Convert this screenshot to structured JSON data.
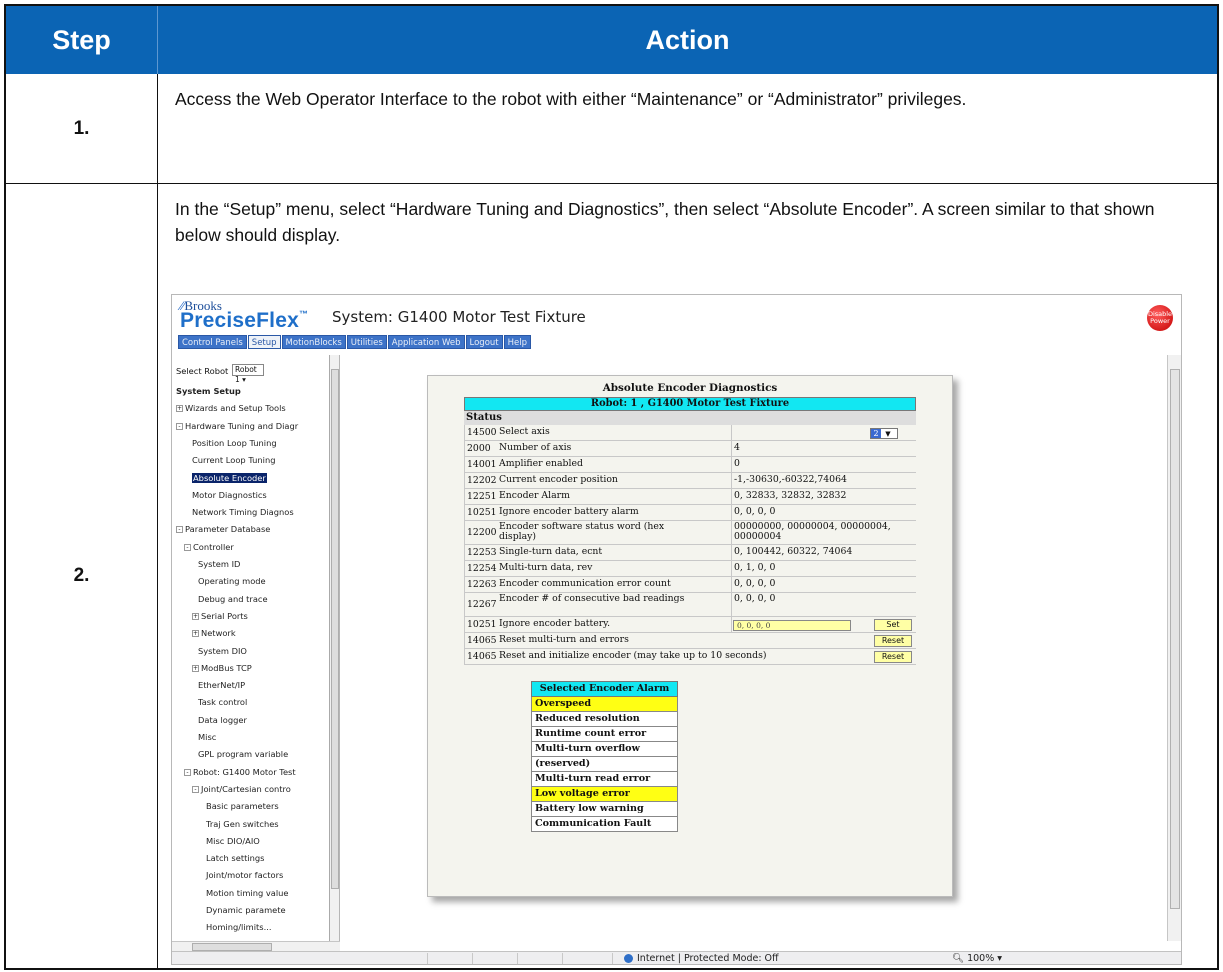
{
  "table": {
    "headers": {
      "step": "Step",
      "action": "Action"
    },
    "rows": [
      {
        "step": "1.",
        "action": "Access the Web Operator Interface to the robot with either “Maintenance” or “Administrator” privileges."
      },
      {
        "step": "2.",
        "action": "In the “Setup” menu, select “Hardware Tuning and Diagnostics”, then select “Absolute Encoder”.  A screen similar to that shown below should display."
      }
    ]
  },
  "screenshot": {
    "logo_brooks": "Brooks",
    "logo_preciseflex": "PreciseFlex",
    "logo_tm": "™",
    "system_title": "System: G1400 Motor Test Fixture",
    "disable_power": "Disable Power",
    "nav": [
      "Control Panels",
      "Setup",
      "MotionBlocks",
      "Utilities",
      "Application Web",
      "Logout",
      "Help"
    ],
    "select_robot_label": "Select Robot",
    "select_robot_value": "Robot 1",
    "tree": [
      {
        "label": "System Setup",
        "bold": true,
        "indent": 0
      },
      {
        "label": "Wizards and Setup Tools",
        "exp": "+",
        "indent": 0
      },
      {
        "label": "Hardware Tuning and Diagr",
        "exp": "-",
        "indent": 0
      },
      {
        "label": "Position Loop Tuning",
        "indent": 2
      },
      {
        "label": "Current Loop Tuning",
        "indent": 2
      },
      {
        "label": "Absolute Encoder",
        "indent": 2,
        "selected": true
      },
      {
        "label": "Motor Diagnostics",
        "indent": 2
      },
      {
        "label": "Network Timing Diagnos",
        "indent": 2
      },
      {
        "label": "Parameter Database",
        "exp": "-",
        "indent": 0
      },
      {
        "label": "Controller",
        "exp": "-",
        "indent": 1
      },
      {
        "label": "System ID",
        "indent": 3
      },
      {
        "label": "Operating mode",
        "indent": 3
      },
      {
        "label": "Debug and trace",
        "indent": 3
      },
      {
        "label": "Serial Ports",
        "exp": "+",
        "indent": 2
      },
      {
        "label": "Network",
        "exp": "+",
        "indent": 2
      },
      {
        "label": "System DIO",
        "indent": 3
      },
      {
        "label": "ModBus TCP",
        "exp": "+",
        "indent": 2
      },
      {
        "label": "EtherNet/IP",
        "indent": 3
      },
      {
        "label": "Task control",
        "indent": 3
      },
      {
        "label": "Data logger",
        "indent": 3
      },
      {
        "label": "Misc",
        "indent": 3
      },
      {
        "label": "GPL program variable",
        "indent": 3
      },
      {
        "label": "Robot: G1400 Motor Test",
        "exp": "-",
        "indent": 1
      },
      {
        "label": "Joint/Cartesian contro",
        "exp": "-",
        "indent": 2
      },
      {
        "label": "Basic parameters",
        "indent": 4
      },
      {
        "label": "Traj Gen switches",
        "indent": 4
      },
      {
        "label": "Misc DIO/AIO",
        "indent": 4
      },
      {
        "label": "Latch settings",
        "indent": 4
      },
      {
        "label": "Joint/motor factors",
        "indent": 4
      },
      {
        "label": "Motion timing value",
        "indent": 4
      },
      {
        "label": "Dynamic paramete",
        "indent": 4
      },
      {
        "label": "Homing/limits...",
        "indent": 4
      }
    ],
    "panel": {
      "title": "Absolute Encoder Diagnostics",
      "robot": "Robot: 1 , G1400 Motor Test Fixture",
      "status": "Status",
      "axis_value": "2",
      "rows": [
        {
          "num": "14500",
          "label": "Select axis",
          "value": "",
          "control": "axis"
        },
        {
          "num": "2000",
          "label": "Number of axis",
          "value": "4"
        },
        {
          "num": "14001",
          "label": "Amplifier enabled",
          "value": "0"
        },
        {
          "num": "12202",
          "label": "Current encoder position",
          "value": "-1,-30630,-60322,74064"
        },
        {
          "num": "12251",
          "label": "Encoder Alarm",
          "value": "0, 32833, 32832, 32832"
        },
        {
          "num": "10251",
          "label": "Ignore encoder battery alarm",
          "value": "0, 0, 0, 0"
        },
        {
          "num": "12200",
          "label": "Encoder software status word (hex display)",
          "value": "00000000, 00000004, 00000004, 00000004",
          "tall": true
        },
        {
          "num": "12253",
          "label": "Single-turn data, ecnt",
          "value": "0, 100442, 60322, 74064"
        },
        {
          "num": "12254",
          "label": "Multi-turn data, rev",
          "value": "0, 1, 0, 0"
        },
        {
          "num": "12263",
          "label": "Encoder communication error count",
          "value": "0, 0, 0, 0"
        },
        {
          "num": "12267",
          "label": "Encoder # of consecutive bad readings",
          "value": "0, 0, 0, 0",
          "tall": true
        },
        {
          "num": "10251",
          "label": "Ignore encoder battery.",
          "value": "0, 0, 0, 0",
          "control": "input",
          "button": "Set"
        },
        {
          "num": "14065",
          "label": "Reset multi-turn and errors",
          "value": "",
          "button": "Reset",
          "wide": true
        },
        {
          "num": "14065",
          "label": "Reset and initialize encoder (may take up to 10 seconds)",
          "value": "",
          "button": "Reset",
          "wide": true
        }
      ]
    },
    "alarm": {
      "header": "Selected Encoder Alarm",
      "items": [
        {
          "label": "Overspeed",
          "highlight": true
        },
        {
          "label": "Reduced resolution",
          "highlight": false
        },
        {
          "label": "Runtime count error",
          "highlight": false
        },
        {
          "label": "Multi-turn overflow",
          "highlight": false
        },
        {
          "label": "(reserved)",
          "highlight": false
        },
        {
          "label": "Multi-turn read error",
          "highlight": false
        },
        {
          "label": "Low voltage error",
          "highlight": true
        },
        {
          "label": "Battery low warning",
          "highlight": false
        },
        {
          "label": "Communication Fault",
          "highlight": false
        }
      ]
    },
    "status_zone": "Internet | Protected Mode: Off",
    "zoom": "100%",
    "colors": {
      "header_blue": "#0b64b4",
      "cyan": "#12e7f2",
      "yellow_highlight": "#ffff14"
    }
  }
}
